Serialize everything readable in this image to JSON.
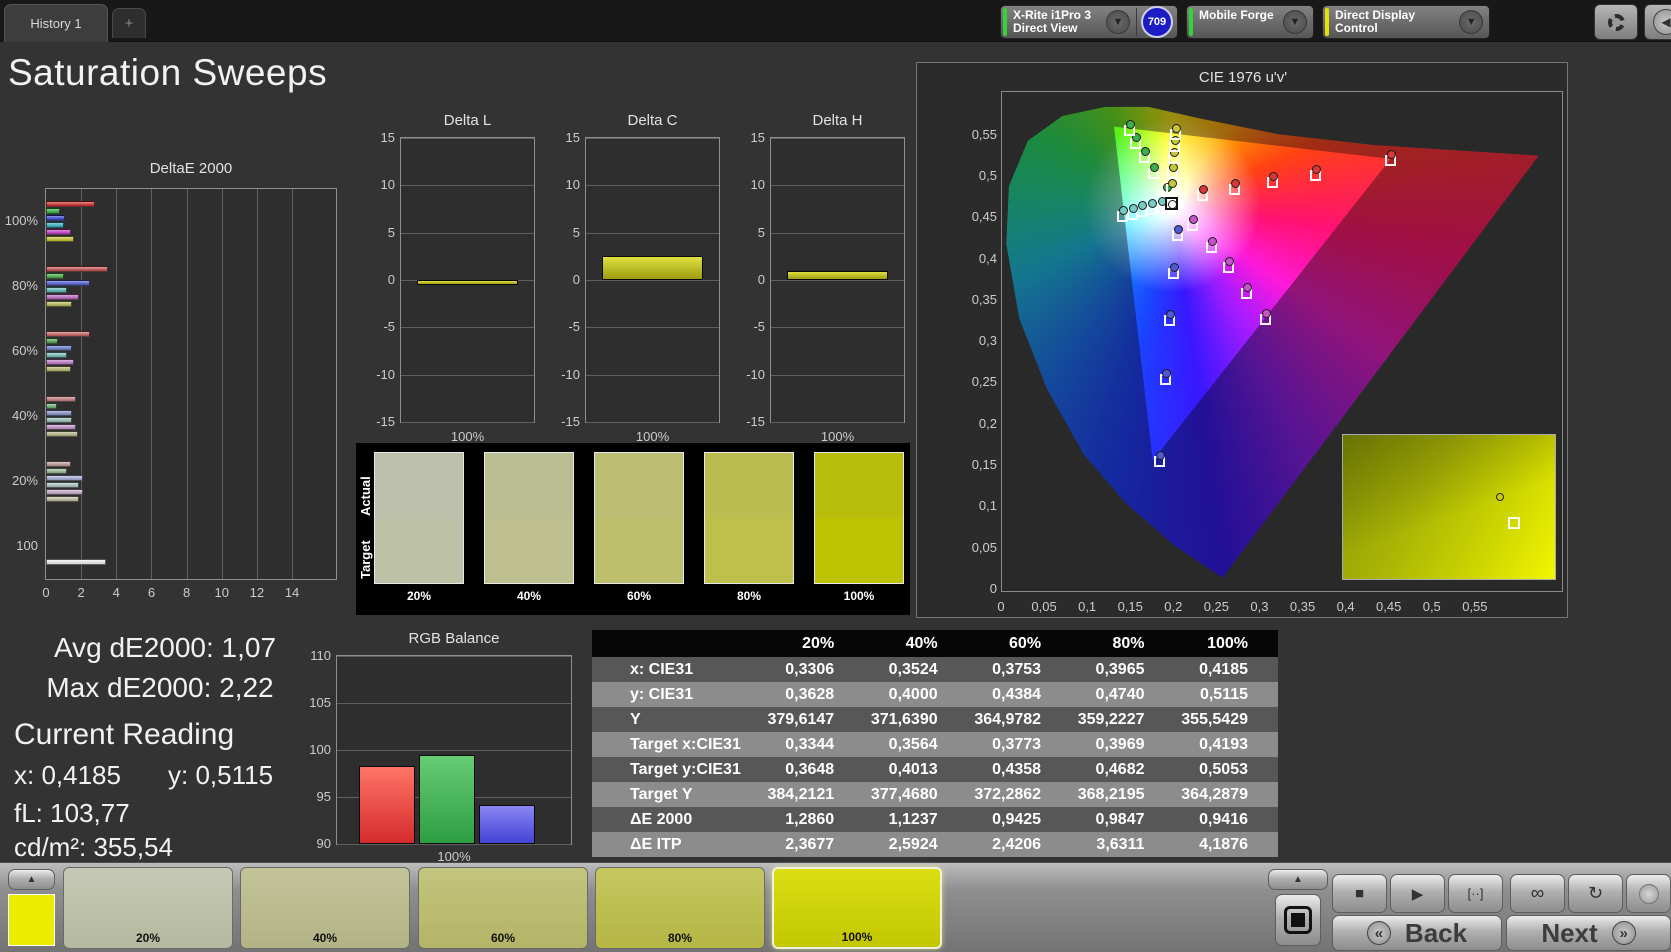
{
  "window": {
    "tab": "History 1",
    "add_tab": "+"
  },
  "toolbar": {
    "meter": {
      "line1": "X-Rite i1Pro 3",
      "line2": "Direct View",
      "badge": "709",
      "stripe": "#35d435"
    },
    "source": {
      "label": "Mobile Forge",
      "stripe": "#35d435"
    },
    "display": {
      "label": "Direct Display Control",
      "stripe": "#e3e307"
    }
  },
  "page_title": "Saturation Sweeps",
  "stats": {
    "avg": "Avg dE2000: 1,07",
    "max": "Max dE2000: 2,22",
    "current": "Current Reading",
    "x": "x: 0,4185",
    "y": "y: 0,5115",
    "fl": "fL: 103,77",
    "cdm2": "cd/m²: 355,54"
  },
  "swatch_strip": {
    "actual": "Actual",
    "target": "Target",
    "swatches": [
      {
        "label": "20%",
        "actual": "#bdc1ac",
        "target": "#bec2a7"
      },
      {
        "label": "40%",
        "actual": "#bbbd93",
        "target": "#bdbf8e"
      },
      {
        "label": "60%",
        "actual": "#bbbd72",
        "target": "#bdbf6d"
      },
      {
        "label": "80%",
        "actual": "#bcbd51",
        "target": "#bec04b"
      },
      {
        "label": "100%",
        "actual": "#b9be0b",
        "target": "#bdc302"
      }
    ]
  },
  "bottom_bar": {
    "reference_color": "#ecec00",
    "up_arrow": "▲",
    "swatches": [
      {
        "label": "20%",
        "c1": "#c6c9b4",
        "c2": "#b5b89e",
        "selected": false
      },
      {
        "label": "40%",
        "c1": "#c3c49a",
        "c2": "#b2b385",
        "selected": false
      },
      {
        "label": "60%",
        "c1": "#c4c57e",
        "c2": "#b3b467",
        "selected": false
      },
      {
        "label": "80%",
        "c1": "#c6c75e",
        "c2": "#b5b646",
        "selected": false
      },
      {
        "label": "100%",
        "c1": "#dade12",
        "c2": "#c3c700",
        "selected": true
      }
    ],
    "transport": [
      {
        "name": "stop",
        "glyph": "■"
      },
      {
        "name": "play",
        "glyph": "▶"
      },
      {
        "name": "single-measure",
        "glyph": "[··]"
      },
      {
        "name": "infinity",
        "glyph": "∞"
      },
      {
        "name": "loop",
        "glyph": "↻"
      },
      {
        "name": "record",
        "glyph": ""
      }
    ],
    "back_chevron": "«",
    "back": "Back",
    "next": "Next",
    "next_chevron": "»"
  },
  "chart_data": [
    {
      "id": "deltae2000",
      "type": "bar",
      "orientation": "horizontal",
      "title": "DeltaE 2000",
      "xlim": [
        0,
        16.5
      ],
      "xticks": [
        0,
        2,
        4,
        6,
        8,
        10,
        12,
        14
      ],
      "groups": [
        {
          "label": "100%",
          "values": [
            2.8,
            0.8,
            1.1,
            1.0,
            1.4,
            1.6
          ],
          "colors": [
            "#d42222",
            "#25b438",
            "#2a3ad0",
            "#28b2c8",
            "#c432c6",
            "#c6c628"
          ]
        },
        {
          "label": "80%",
          "values": [
            3.5,
            1.0,
            2.5,
            1.2,
            1.9,
            1.5
          ],
          "colors": [
            "#c84848",
            "#38aa3c",
            "#4656d2",
            "#58bab6",
            "#ba60c2",
            "#b8b84e"
          ]
        },
        {
          "label": "60%",
          "values": [
            2.5,
            0.7,
            1.5,
            1.2,
            1.6,
            1.4
          ],
          "colors": [
            "#c85c5c",
            "#48a648",
            "#6274ca",
            "#74beb6",
            "#c274ca",
            "#b6b666"
          ]
        },
        {
          "label": "40%",
          "values": [
            1.7,
            0.6,
            1.5,
            1.5,
            1.7,
            1.8
          ],
          "colors": [
            "#c47878",
            "#68ae68",
            "#8490ce",
            "#92c2ba",
            "#c490cc",
            "#b6b684"
          ]
        },
        {
          "label": "20%",
          "values": [
            1.4,
            1.2,
            2.1,
            1.9,
            2.1,
            1.9
          ],
          "colors": [
            "#c29696",
            "#96bc96",
            "#a4acd8",
            "#aac6be",
            "#caaace",
            "#bebe9e"
          ]
        },
        {
          "label": "100",
          "values": [
            3.4
          ],
          "colors": [
            "#f2f2f2"
          ]
        }
      ]
    },
    {
      "id": "delta_l",
      "type": "bar",
      "title": "Delta L",
      "value": -0.5,
      "ylim": [
        -15,
        15
      ],
      "yticks": [
        15,
        10,
        5,
        0,
        -5,
        -10,
        -15
      ],
      "xlabel": "100%",
      "bar_color": "#c8c81e"
    },
    {
      "id": "delta_c",
      "type": "bar",
      "title": "Delta C",
      "value": 2.5,
      "ylim": [
        -15,
        15
      ],
      "yticks": [
        15,
        10,
        5,
        0,
        -5,
        -10,
        -15
      ],
      "xlabel": "100%",
      "bar_color": "#c8c81e"
    },
    {
      "id": "delta_h",
      "type": "bar",
      "title": "Delta H",
      "value": 1.0,
      "ylim": [
        -15,
        15
      ],
      "yticks": [
        15,
        10,
        5,
        0,
        -5,
        -10,
        -15
      ],
      "xlabel": "100%",
      "bar_color": "#c8c81e"
    },
    {
      "id": "rgb_balance",
      "type": "bar",
      "title": "RGB Balance",
      "categories": [
        "Red",
        "Green",
        "Blue"
      ],
      "values": [
        98.3,
        99.5,
        94.2
      ],
      "colors": [
        "#e84438",
        "#3aa84e",
        "#5a52e0"
      ],
      "ylim": [
        90,
        110
      ],
      "yticks": [
        110,
        105,
        100,
        95,
        90
      ],
      "xlabel": "100%"
    },
    {
      "id": "cie1976",
      "type": "scatter",
      "title": "CIE 1976 u'v'",
      "xlim": [
        0,
        0.65
      ],
      "ylim": [
        0,
        0.604
      ],
      "xticks": [
        "0",
        "0,05",
        "0,1",
        "0,15",
        "0,2",
        "0,25",
        "0,3",
        "0,35",
        "0,4",
        "0,45",
        "0,5",
        "0,55"
      ],
      "yticks": [
        "0,55",
        "0,5",
        "0,45",
        "0,4",
        "0,35",
        "0,3",
        "0,25",
        "0,2",
        "0,15",
        "0,1",
        "0,05",
        "0"
      ],
      "white_point": {
        "u": 0.1978,
        "v": 0.4683
      },
      "gamut_triangle": [
        [
          0.451,
          0.523
        ],
        [
          0.13,
          0.562
        ],
        [
          0.175,
          0.158
        ]
      ],
      "sweeps": [
        {
          "name": "red",
          "color": "#d83838",
          "points": [
            [
              0.233,
              0.48
            ],
            [
              0.27,
              0.488
            ],
            [
              0.315,
              0.496
            ],
            [
              0.365,
              0.505
            ],
            [
              0.451,
              0.523
            ]
          ]
        },
        {
          "name": "green",
          "color": "#3cb04c",
          "points": [
            [
              0.191,
              0.483
            ],
            [
              0.176,
              0.507
            ],
            [
              0.166,
              0.527
            ],
            [
              0.156,
              0.544
            ],
            [
              0.148,
              0.559
            ]
          ]
        },
        {
          "name": "blue",
          "color": "#5058d4",
          "points": [
            [
              0.204,
              0.432
            ],
            [
              0.2,
              0.386
            ],
            [
              0.195,
              0.329
            ],
            [
              0.19,
              0.258
            ],
            [
              0.183,
              0.159
            ]
          ]
        },
        {
          "name": "cyan",
          "color": "#74ccc4",
          "points": [
            [
              0.186,
              0.4665
            ],
            [
              0.174,
              0.4635
            ],
            [
              0.163,
              0.461
            ],
            [
              0.152,
              0.458
            ],
            [
              0.14,
              0.455
            ]
          ]
        },
        {
          "name": "magenta",
          "color": "#c654c8",
          "points": [
            [
              0.222,
              0.444
            ],
            [
              0.2435,
              0.4175
            ],
            [
              0.263,
              0.393
            ],
            [
              0.2845,
              0.362
            ],
            [
              0.306,
              0.33
            ]
          ]
        },
        {
          "name": "yellow",
          "color": "#c6c63c",
          "points": [
            [
              0.1976,
              0.488
            ],
            [
              0.1987,
              0.5073
            ],
            [
              0.1999,
              0.5254
            ],
            [
              0.2009,
              0.5404
            ],
            [
              0.2017,
              0.5546
            ]
          ]
        }
      ],
      "inset_markers": {
        "circle": [
          72,
          40
        ],
        "square": [
          78,
          57
        ]
      }
    },
    {
      "id": "results",
      "type": "table",
      "columns": [
        "20%",
        "40%",
        "60%",
        "80%",
        "100%"
      ],
      "rows": [
        {
          "label": "x: CIE31",
          "values": [
            "0,3306",
            "0,3524",
            "0,3753",
            "0,3965",
            "0,4185"
          ]
        },
        {
          "label": "y: CIE31",
          "values": [
            "0,3628",
            "0,4000",
            "0,4384",
            "0,4740",
            "0,5115"
          ]
        },
        {
          "label": "Y",
          "values": [
            "379,6147",
            "371,6390",
            "364,9782",
            "359,2227",
            "355,5429"
          ]
        },
        {
          "label": "Target x:CIE31",
          "values": [
            "0,3344",
            "0,3564",
            "0,3773",
            "0,3969",
            "0,4193"
          ]
        },
        {
          "label": "Target y:CIE31",
          "values": [
            "0,3648",
            "0,4013",
            "0,4358",
            "0,4682",
            "0,5053"
          ]
        },
        {
          "label": "Target Y",
          "values": [
            "384,2121",
            "377,4680",
            "372,2862",
            "368,2195",
            "364,2879"
          ]
        },
        {
          "label": "ΔE 2000",
          "values": [
            "1,2860",
            "1,1237",
            "0,9425",
            "0,9847",
            "0,9416"
          ]
        },
        {
          "label": "ΔE ITP",
          "values": [
            "2,3677",
            "2,5924",
            "2,4206",
            "3,6311",
            "4,1876"
          ]
        }
      ]
    }
  ]
}
